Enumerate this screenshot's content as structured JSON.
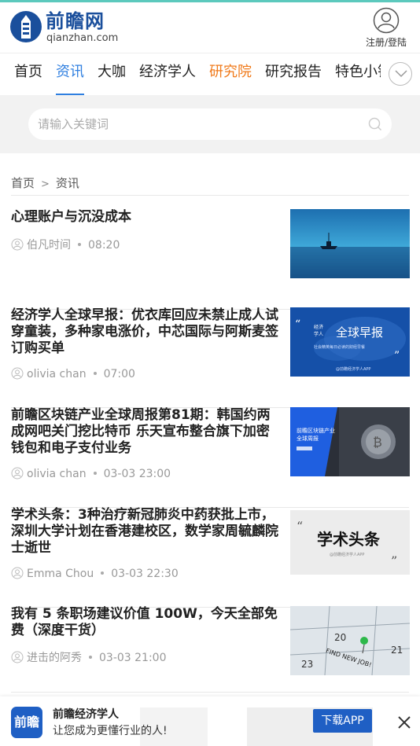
{
  "header": {
    "logo_cn": "前瞻网",
    "logo_en": "qianzhan.com",
    "user_label": "注册/登陆"
  },
  "nav": {
    "items": [
      {
        "label": "首页",
        "state": "normal"
      },
      {
        "label": "资讯",
        "state": "active"
      },
      {
        "label": "大咖",
        "state": "normal"
      },
      {
        "label": "经济学人",
        "state": "normal"
      },
      {
        "label": "研究院",
        "state": "highlight"
      },
      {
        "label": "研究报告",
        "state": "normal"
      },
      {
        "label": "特色小镇",
        "state": "normal"
      }
    ],
    "active_color": "#2f7fe0",
    "highlight_color": "#f07a1a"
  },
  "search": {
    "placeholder": "请输入关键词",
    "value": ""
  },
  "breadcrumb": {
    "home": "首页",
    "separator": ">",
    "current": "资讯"
  },
  "articles": [
    {
      "title": "心理账户与沉没成本",
      "author": "伯凡时间",
      "time": "08:20",
      "thumb": "boat-at-sea"
    },
    {
      "title": "经济学人全球早报：优衣库回应未禁止成人试穿童装，多种家电涨价，中芯国际与阿斯麦签订购买单",
      "author": "olivia chan",
      "time": "07:00",
      "thumb": "global-morning-report",
      "thumb_text": {
        "small1": "经济",
        "small2": "学人",
        "big": "全球早报",
        "sub": "社会精英每日必读的财经早餐",
        "foot": "@前瞻经济学人APP"
      }
    },
    {
      "title": "前瞻区块链产业全球周报第81期：韩国约两成网吧关门挖比特币 乐天宣布整合旗下加密钱包和电子支付业务",
      "author": "olivia chan",
      "time": "03-03 23:00",
      "thumb": "blockchain-weekly",
      "thumb_text": {
        "line1": "前瞻区块链产业",
        "line2": "全球周报"
      }
    },
    {
      "title": "学术头条：3种治疗新冠肺炎中药获批上市，深圳大学计划在香港建校区，数学家周毓麟院士逝世",
      "author": "Emma Chou",
      "time": "03-03 22:30",
      "thumb": "academic-headlines",
      "thumb_text": {
        "big": "学术头条",
        "sub": "@前瞻经济学人APP"
      }
    },
    {
      "title": "我有 5 条职场建议价值 100W，今天全部免费（深度干货）",
      "author": "进击的阿秀",
      "time": "03-03 21:00",
      "thumb": "calendar-pin",
      "thumb_text": {
        "d1": "20",
        "d2": "21",
        "d3": "23",
        "note": "FIND NEW JOB!"
      }
    }
  ],
  "banner": {
    "logo": "前瞻",
    "title": "前瞻经济学人",
    "subtitle": "让您成为更懂行业的人!",
    "button": "下载APP"
  }
}
